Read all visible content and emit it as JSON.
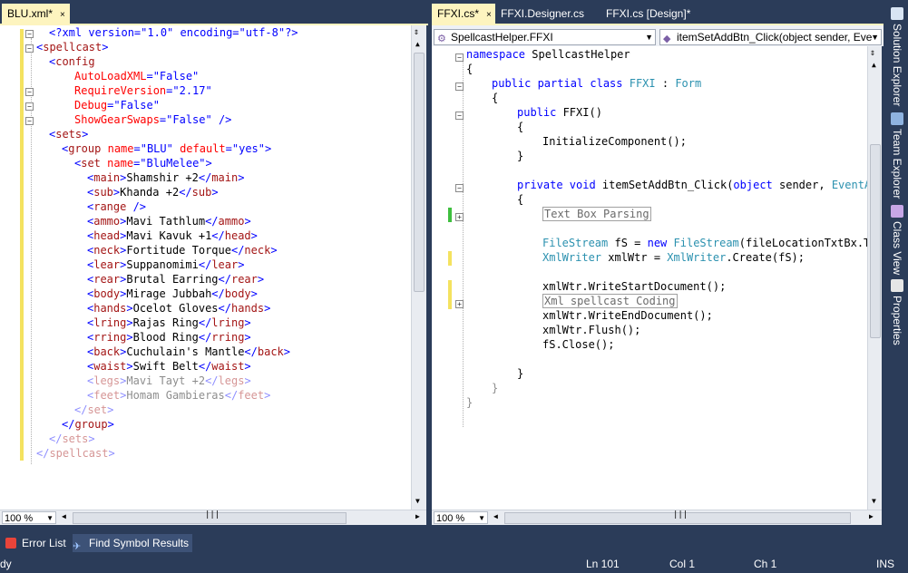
{
  "tabs_left": [
    {
      "label": "BLU.xml*",
      "close": "×"
    }
  ],
  "tabs_right": [
    {
      "label": "FFXI.cs*",
      "close": "×"
    },
    {
      "label": "FFXI.Designer.cs"
    },
    {
      "label": "FFXI.cs [Design]*"
    }
  ],
  "left_code": [
    {
      "p": [
        [
          "blue",
          "<?xml version=\"1.0\" encoding=\"utf-8\"?>"
        ]
      ],
      "i": 1
    },
    {
      "p": [
        [
          "blue",
          "<"
        ],
        [
          "br",
          "spellcast"
        ],
        [
          "blue",
          ">"
        ]
      ],
      "i": 0
    },
    {
      "p": [
        [
          "blue",
          "<"
        ],
        [
          "br",
          "config"
        ]
      ],
      "i": 1
    },
    {
      "p": [
        [
          "red",
          "AutoLoadXML"
        ],
        [
          "blue",
          "=\"False\""
        ]
      ],
      "i": 3
    },
    {
      "p": [
        [
          "red",
          "RequireVersion"
        ],
        [
          "blue",
          "=\"2.17\""
        ]
      ],
      "i": 3
    },
    {
      "p": [
        [
          "red",
          "Debug"
        ],
        [
          "blue",
          "=\"False\""
        ]
      ],
      "i": 3
    },
    {
      "p": [
        [
          "red",
          "ShowGearSwaps"
        ],
        [
          "blue",
          "=\"False\" />"
        ]
      ],
      "i": 3
    },
    {
      "p": [
        [
          "blue",
          "<"
        ],
        [
          "br",
          "sets"
        ],
        [
          "blue",
          ">"
        ]
      ],
      "i": 1
    },
    {
      "p": [
        [
          "blue",
          "<"
        ],
        [
          "br",
          "group"
        ],
        [
          "blk",
          " "
        ],
        [
          "red",
          "name"
        ],
        [
          "blue",
          "=\"BLU\" "
        ],
        [
          "red",
          "default"
        ],
        [
          "blue",
          "=\"yes\">"
        ]
      ],
      "i": 2
    },
    {
      "p": [
        [
          "blue",
          "<"
        ],
        [
          "br",
          "set"
        ],
        [
          "blk",
          " "
        ],
        [
          "red",
          "name"
        ],
        [
          "blue",
          "=\"BluMelee\">"
        ]
      ],
      "i": 3
    },
    {
      "p": [
        [
          "blue",
          "<"
        ],
        [
          "br",
          "main"
        ],
        [
          "blue",
          ">"
        ],
        [
          "blk",
          "Shamshir +2"
        ],
        [
          "blue",
          "</"
        ],
        [
          "br",
          "main"
        ],
        [
          "blue",
          ">"
        ]
      ],
      "i": 4
    },
    {
      "p": [
        [
          "blue",
          "<"
        ],
        [
          "br",
          "sub"
        ],
        [
          "blue",
          ">"
        ],
        [
          "blk",
          "Khanda +2"
        ],
        [
          "blue",
          "</"
        ],
        [
          "br",
          "sub"
        ],
        [
          "blue",
          ">"
        ]
      ],
      "i": 4
    },
    {
      "p": [
        [
          "blue",
          "<"
        ],
        [
          "br",
          "range"
        ],
        [
          "blue",
          " />"
        ]
      ],
      "i": 4
    },
    {
      "p": [
        [
          "blue",
          "<"
        ],
        [
          "br",
          "ammo"
        ],
        [
          "blue",
          ">"
        ],
        [
          "blk",
          "Mavi Tathlum"
        ],
        [
          "blue",
          "</"
        ],
        [
          "br",
          "ammo"
        ],
        [
          "blue",
          ">"
        ]
      ],
      "i": 4
    },
    {
      "p": [
        [
          "blue",
          "<"
        ],
        [
          "br",
          "head"
        ],
        [
          "blue",
          ">"
        ],
        [
          "blk",
          "Mavi Kavuk +1"
        ],
        [
          "blue",
          "</"
        ],
        [
          "br",
          "head"
        ],
        [
          "blue",
          ">"
        ]
      ],
      "i": 4
    },
    {
      "p": [
        [
          "blue",
          "<"
        ],
        [
          "br",
          "neck"
        ],
        [
          "blue",
          ">"
        ],
        [
          "blk",
          "Fortitude Torque"
        ],
        [
          "blue",
          "</"
        ],
        [
          "br",
          "neck"
        ],
        [
          "blue",
          ">"
        ]
      ],
      "i": 4
    },
    {
      "p": [
        [
          "blue",
          "<"
        ],
        [
          "br",
          "lear"
        ],
        [
          "blue",
          ">"
        ],
        [
          "blk",
          "Suppanomimi"
        ],
        [
          "blue",
          "</"
        ],
        [
          "br",
          "lear"
        ],
        [
          "blue",
          ">"
        ]
      ],
      "i": 4
    },
    {
      "p": [
        [
          "blue",
          "<"
        ],
        [
          "br",
          "rear"
        ],
        [
          "blue",
          ">"
        ],
        [
          "blk",
          "Brutal Earring"
        ],
        [
          "blue",
          "</"
        ],
        [
          "br",
          "rear"
        ],
        [
          "blue",
          ">"
        ]
      ],
      "i": 4
    },
    {
      "p": [
        [
          "blue",
          "<"
        ],
        [
          "br",
          "body"
        ],
        [
          "blue",
          ">"
        ],
        [
          "blk",
          "Mirage Jubbah"
        ],
        [
          "blue",
          "</"
        ],
        [
          "br",
          "body"
        ],
        [
          "blue",
          ">"
        ]
      ],
      "i": 4
    },
    {
      "p": [
        [
          "blue",
          "<"
        ],
        [
          "br",
          "hands"
        ],
        [
          "blue",
          ">"
        ],
        [
          "blk",
          "Ocelot Gloves"
        ],
        [
          "blue",
          "</"
        ],
        [
          "br",
          "hands"
        ],
        [
          "blue",
          ">"
        ]
      ],
      "i": 4
    },
    {
      "p": [
        [
          "blue",
          "<"
        ],
        [
          "br",
          "lring"
        ],
        [
          "blue",
          ">"
        ],
        [
          "blk",
          "Rajas Ring"
        ],
        [
          "blue",
          "</"
        ],
        [
          "br",
          "lring"
        ],
        [
          "blue",
          ">"
        ]
      ],
      "i": 4
    },
    {
      "p": [
        [
          "blue",
          "<"
        ],
        [
          "br",
          "rring"
        ],
        [
          "blue",
          ">"
        ],
        [
          "blk",
          "Blood Ring"
        ],
        [
          "blue",
          "</"
        ],
        [
          "br",
          "rring"
        ],
        [
          "blue",
          ">"
        ]
      ],
      "i": 4
    },
    {
      "p": [
        [
          "blue",
          "<"
        ],
        [
          "br",
          "back"
        ],
        [
          "blue",
          ">"
        ],
        [
          "blk",
          "Cuchulain's Mantle"
        ],
        [
          "blue",
          "</"
        ],
        [
          "br",
          "back"
        ],
        [
          "blue",
          ">"
        ]
      ],
      "i": 4
    },
    {
      "p": [
        [
          "blue",
          "<"
        ],
        [
          "br",
          "waist"
        ],
        [
          "blue",
          ">"
        ],
        [
          "blk",
          "Swift Belt"
        ],
        [
          "blue",
          "</"
        ],
        [
          "br",
          "waist"
        ],
        [
          "blue",
          ">"
        ]
      ],
      "i": 4
    },
    {
      "p": [
        [
          "blue",
          "<"
        ],
        [
          "br",
          "legs"
        ],
        [
          "blue",
          ">"
        ],
        [
          "blk",
          "Mavi Tayt +2"
        ],
        [
          "blue",
          "</"
        ],
        [
          "br",
          "legs"
        ],
        [
          "blue",
          ">"
        ]
      ],
      "i": 4,
      "dim": true
    },
    {
      "p": [
        [
          "blue",
          "<"
        ],
        [
          "br",
          "feet"
        ],
        [
          "blue",
          ">"
        ],
        [
          "blk",
          "Homam Gambieras"
        ],
        [
          "blue",
          "</"
        ],
        [
          "br",
          "feet"
        ],
        [
          "blue",
          ">"
        ]
      ],
      "i": 4,
      "dim": true
    },
    {
      "p": [
        [
          "blue",
          "</"
        ],
        [
          "br",
          "set"
        ],
        [
          "blue",
          ">"
        ]
      ],
      "i": 3,
      "dim": true
    },
    {
      "p": [
        [
          "blue",
          "</"
        ],
        [
          "br",
          "group"
        ],
        [
          "blue",
          ">"
        ]
      ],
      "i": 2
    },
    {
      "p": [
        [
          "blue",
          "</"
        ],
        [
          "br",
          "sets"
        ],
        [
          "blue",
          ">"
        ]
      ],
      "i": 1,
      "dim": true
    },
    {
      "p": [
        [
          "blue",
          "</"
        ],
        [
          "br",
          "spellcast"
        ],
        [
          "blue",
          ">"
        ]
      ],
      "i": 0,
      "dim": true
    }
  ],
  "left_zoom": "100 %",
  "right_combo_class": "SpellcastHelper.FFXI",
  "right_combo_member": "itemSetAddBtn_Click(object sender, Eve",
  "right_code": [
    {
      "p": [
        [
          "blue",
          "namespace"
        ],
        [
          "blk",
          " SpellcastHelper"
        ]
      ],
      "i": 0
    },
    {
      "p": [
        [
          "blk",
          "{"
        ]
      ],
      "i": 0
    },
    {
      "p": [
        [
          "blue",
          "public partial class"
        ],
        [
          "blk",
          " "
        ],
        [
          "teal",
          "FFXI"
        ],
        [
          "blk",
          " : "
        ],
        [
          "teal",
          "Form"
        ]
      ],
      "i": 1
    },
    {
      "p": [
        [
          "blk",
          "{"
        ]
      ],
      "i": 1
    },
    {
      "p": [
        [
          "blue",
          "public"
        ],
        [
          "blk",
          " FFXI()"
        ]
      ],
      "i": 2
    },
    {
      "p": [
        [
          "blk",
          "{"
        ]
      ],
      "i": 2
    },
    {
      "p": [
        [
          "blk",
          "InitializeComponent();"
        ]
      ],
      "i": 3
    },
    {
      "p": [
        [
          "blk",
          "}"
        ]
      ],
      "i": 2
    },
    {
      "p": [
        [
          "blk",
          ""
        ]
      ],
      "i": 0
    },
    {
      "p": [
        [
          "blue",
          "private void"
        ],
        [
          "blk",
          " itemSetAddBtn_Click("
        ],
        [
          "blue",
          "object"
        ],
        [
          "blk",
          " sender, "
        ],
        [
          "teal",
          "EventAr"
        ]
      ],
      "i": 2
    },
    {
      "p": [
        [
          "blk",
          "{"
        ]
      ],
      "i": 2
    },
    {
      "p": [
        [
          "box",
          "Text Box Parsing"
        ]
      ],
      "i": 3
    },
    {
      "p": [
        [
          "blk",
          ""
        ]
      ],
      "i": 0
    },
    {
      "p": [
        [
          "teal",
          "FileStream"
        ],
        [
          "blk",
          " fS = "
        ],
        [
          "blue",
          "new"
        ],
        [
          "blk",
          " "
        ],
        [
          "teal",
          "FileStream"
        ],
        [
          "blk",
          "(fileLocationTxtBx.Te"
        ]
      ],
      "i": 3
    },
    {
      "p": [
        [
          "teal",
          "XmlWriter"
        ],
        [
          "blk",
          " xmlWtr = "
        ],
        [
          "teal",
          "XmlWriter"
        ],
        [
          "blk",
          ".Create(fS);"
        ]
      ],
      "i": 3
    },
    {
      "p": [
        [
          "blk",
          ""
        ]
      ],
      "i": 0
    },
    {
      "p": [
        [
          "blk",
          "xmlWtr.WriteStartDocument();"
        ]
      ],
      "i": 3
    },
    {
      "p": [
        [
          "box",
          "Xml spellcast Coding"
        ]
      ],
      "i": 3
    },
    {
      "p": [
        [
          "blk",
          "xmlWtr.WriteEndDocument();"
        ]
      ],
      "i": 3
    },
    {
      "p": [
        [
          "blk",
          "xmlWtr.Flush();"
        ]
      ],
      "i": 3
    },
    {
      "p": [
        [
          "blk",
          "fS.Close();"
        ]
      ],
      "i": 3
    },
    {
      "p": [
        [
          "blk",
          ""
        ]
      ],
      "i": 0
    },
    {
      "p": [
        [
          "blk",
          "}"
        ]
      ],
      "i": 2
    },
    {
      "p": [
        [
          "blk",
          "}"
        ]
      ],
      "i": 1,
      "dim": true
    },
    {
      "p": [
        [
          "blk",
          "}"
        ]
      ],
      "i": 0,
      "dim": true
    }
  ],
  "right_zoom": "100 %",
  "side_tabs": [
    "Solution Explorer",
    "Team Explorer",
    "Class View",
    "Properties"
  ],
  "bottom_tabs": [
    "Error List",
    "Find Symbol Results"
  ],
  "status": {
    "left": "dy",
    "ln": "Ln 101",
    "col": "Col 1",
    "ch": "Ch 1",
    "mode": "INS"
  },
  "colors": {
    "chrome": "#2b3c59",
    "active_tab": "#fdf4bf",
    "changed_marker": "#f4e25f",
    "saved_marker": "#3fbf3f"
  }
}
